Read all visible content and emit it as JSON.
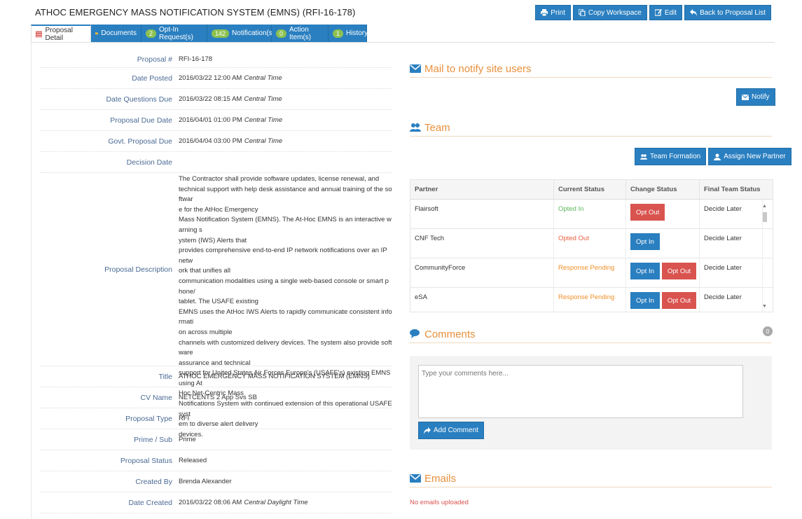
{
  "page": {
    "title": "ATHOC EMERGENCY MASS NOTIFICATION SYSTEM (EMNS) (RFI-16-178)"
  },
  "toolbar": {
    "print": "Print",
    "copy_workspace": "Copy Workspace",
    "edit": "Edit",
    "back": "Back to Proposal List"
  },
  "tabs": [
    {
      "label": "Proposal Detail",
      "badge": ""
    },
    {
      "label": "Documents",
      "badge": ""
    },
    {
      "label": "Opt-In Request(s)",
      "badge": "2"
    },
    {
      "label": "Notification(s)",
      "badge": "142"
    },
    {
      "label": "Action Item(s)",
      "badge": "0"
    },
    {
      "label": "History",
      "badge": "1"
    }
  ],
  "details": {
    "proposal_num": {
      "label": "Proposal #",
      "value": "RFI-16-178"
    },
    "date_posted": {
      "label": "Date Posted",
      "value": "2016/03/22 12:00 AM",
      "tz": "Central Time"
    },
    "date_questions_due": {
      "label": "Date Questions Due",
      "value": "2016/03/22 08:15 AM",
      "tz": "Central Time"
    },
    "proposal_due_date": {
      "label": "Proposal Due Date",
      "value": "2016/04/01 01:00 PM",
      "tz": "Central Time"
    },
    "govt_proposal_due": {
      "label": "Govt. Proposal Due",
      "value": "2016/04/04 03:00 PM",
      "tz": "Central Time"
    },
    "decision_date": {
      "label": "Decision Date",
      "value": ""
    },
    "description": {
      "label": "Proposal Description",
      "lines": [
        "The Contractor shall provide software updates, license renewal, and",
        "technical support with help desk assistance and annual training of the softwar",
        "e for the AtHoc Emergency",
        "Mass Notification System (EMNS). The At-Hoc EMNS is an interactive warning s",
        "ystem (IWS) Alerts that",
        "provides comprehensive end-to-end IP network notifications over an IP netw",
        "ork that unifies all",
        "communication modalities using a single web-based console or smart phone/",
        "tablet. The USAFE existing",
        "EMNS uses the AtHoc IWS Alerts to rapidly communicate consistent informati",
        "on across multiple",
        "channels with customized delivery devices. The system also provide software",
        "assurance and technical",
        "support for United States Air Forces Europe's (USAFE's) existing EMNS using At",
        "Hoc Net-Centric Mass",
        "Notifications System with continued extension of this operational USAFE syst",
        "em to diverse alert delivery",
        "devices."
      ]
    },
    "title": {
      "label": "Title",
      "value": "ATHOC EMERGENCY MASS NOTIFICATION SYSTEM (EMNS)"
    },
    "cv_name": {
      "label": "CV Name",
      "value": "NETCENTS 2 App Svs SB"
    },
    "proposal_type": {
      "label": "Proposal Type",
      "value": "RFI"
    },
    "prime_sub": {
      "label": "Prime / Sub",
      "value": "Prime"
    },
    "proposal_status": {
      "label": "Proposal Status",
      "value": "Released"
    },
    "created_by": {
      "label": "Created By",
      "value": "Brenda Alexander"
    },
    "date_created": {
      "label": "Date Created",
      "value": "2016/03/22 08:06 AM",
      "tz": "Central Daylight Time"
    }
  },
  "mail": {
    "heading": "Mail to notify site users",
    "notify": "Notify"
  },
  "team": {
    "heading": "Team",
    "team_formation": "Team Formation",
    "assign_partner": "Assign New Partner",
    "columns": {
      "partner": "Partner",
      "current_status": "Current Status",
      "change_status": "Change Status",
      "final_status": "Final Team Status"
    },
    "rows": [
      {
        "partner": "Flairsoft",
        "status": "Opted In",
        "final": "Decide Later"
      },
      {
        "partner": "CNF Tech",
        "status": "Opted Out",
        "final": "Decide Later"
      },
      {
        "partner": "CommunityForce",
        "status": "Response Pending",
        "final": "Decide Later"
      },
      {
        "partner": "eSA",
        "status": "Response Pending",
        "final": "Decide Later"
      }
    ],
    "opt_in": "Opt In",
    "opt_out": "Opt Out",
    "colors": {
      "opted_in": "#5cb85c",
      "opted_out": "#e8603c",
      "pending": "#f0902a"
    }
  },
  "comments": {
    "heading": "Comments",
    "count": "0",
    "placeholder": "Type your comments here...",
    "add": "Add Comment"
  },
  "emails": {
    "heading": "Emails",
    "empty": "No emails uploaded"
  }
}
